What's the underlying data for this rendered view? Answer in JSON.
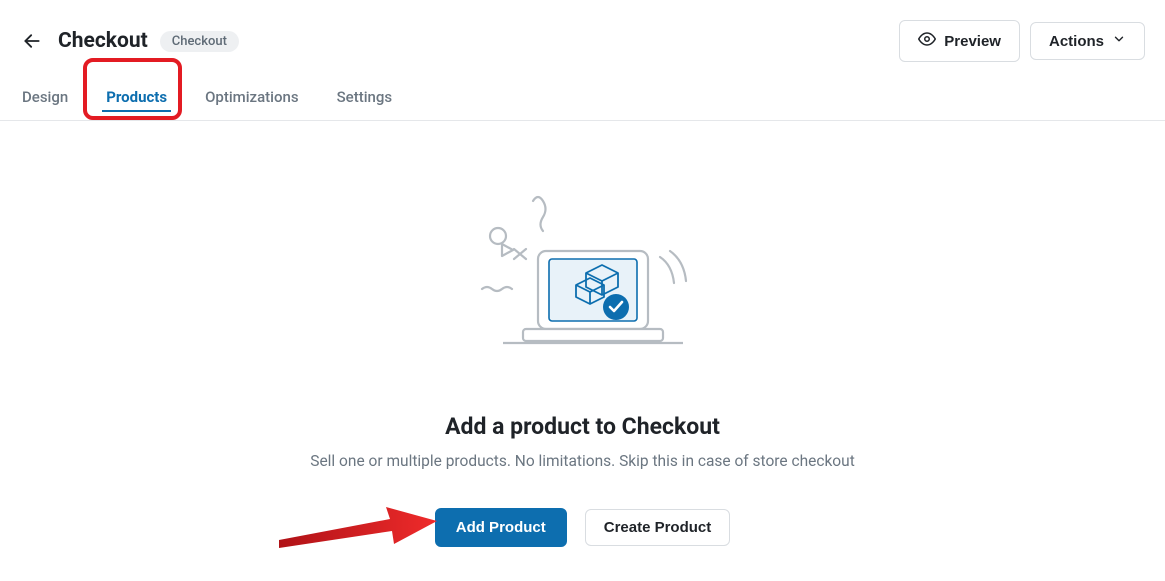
{
  "header": {
    "title": "Checkout",
    "badge": "Checkout",
    "preview": "Preview",
    "actions": "Actions"
  },
  "tabs": [
    {
      "label": "Design"
    },
    {
      "label": "Products"
    },
    {
      "label": "Optimizations"
    },
    {
      "label": "Settings"
    }
  ],
  "activeTabIndex": 1,
  "empty": {
    "title": "Add a product to Checkout",
    "subtitle": "Sell one or multiple products. No limitations. Skip this in case of store checkout",
    "addProduct": "Add Product",
    "createProduct": "Create Product"
  },
  "colors": {
    "accent": "#0D6EAF",
    "highlight": "#e31b23",
    "muted": "#6b7681"
  }
}
